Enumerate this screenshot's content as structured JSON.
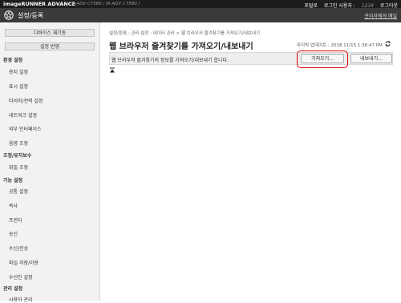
{
  "topbar": {
    "brand": "imageRUNNER ADVANCE",
    "model": "iR-ADV C7580 / iR-ADV C7580 /",
    "portal": "포털로",
    "login_label": "로그인 사용자 :",
    "user": "1234",
    "logout": "로그아웃"
  },
  "header": {
    "title": "설정/등록",
    "admin_link": "관리자에게 메일"
  },
  "sidebar": {
    "buttons": [
      "디바이스 재기동",
      "설정 반영"
    ],
    "sections": [
      {
        "title": "환경 설정",
        "items": [
          "용지 설정",
          "표시 설정",
          "타이머/전력 설정",
          "네트워크 설정",
          "외부 인터페이스",
          "음량 조정"
        ]
      },
      {
        "title": "조정/유지보수",
        "items": [
          "화질 조정"
        ]
      },
      {
        "title": "기능 설정",
        "items": [
          "공통 설정",
          "복사",
          "프린터",
          "송신",
          "수신/전송",
          "파일 저장/이용"
        ]
      },
      {
        "title": "",
        "items": [
          "수신인 설정"
        ]
      },
      {
        "title": "관리 설정",
        "items": [
          "사용자 관리"
        ]
      }
    ]
  },
  "main": {
    "breadcrumb": "설정/등록 : 관리 설정 : 데이터 관리 > 웹 브라우저 즐겨찾기를 가져오기/내보내기",
    "heading": "웹 브라우저 즐겨찾기를 가져오기/내보내기",
    "last_update": "마지막 업데이트 : 2018 11/15 1:36:47 PM",
    "description": "웹 브라우저 즐겨찾기의 정보를 가져오기/내보내기 합니다.",
    "import_button": "가져오기...",
    "export_button": "내보내기..."
  },
  "icons": {
    "title_icon": "settings-gear-icon",
    "refresh_icon": "refresh-icon",
    "to_top_icon": "to-top-icon"
  },
  "colors": {
    "topbar": "#1d1d1d",
    "titlebar": "#3a3a3a",
    "highlight": "#dd0000"
  }
}
